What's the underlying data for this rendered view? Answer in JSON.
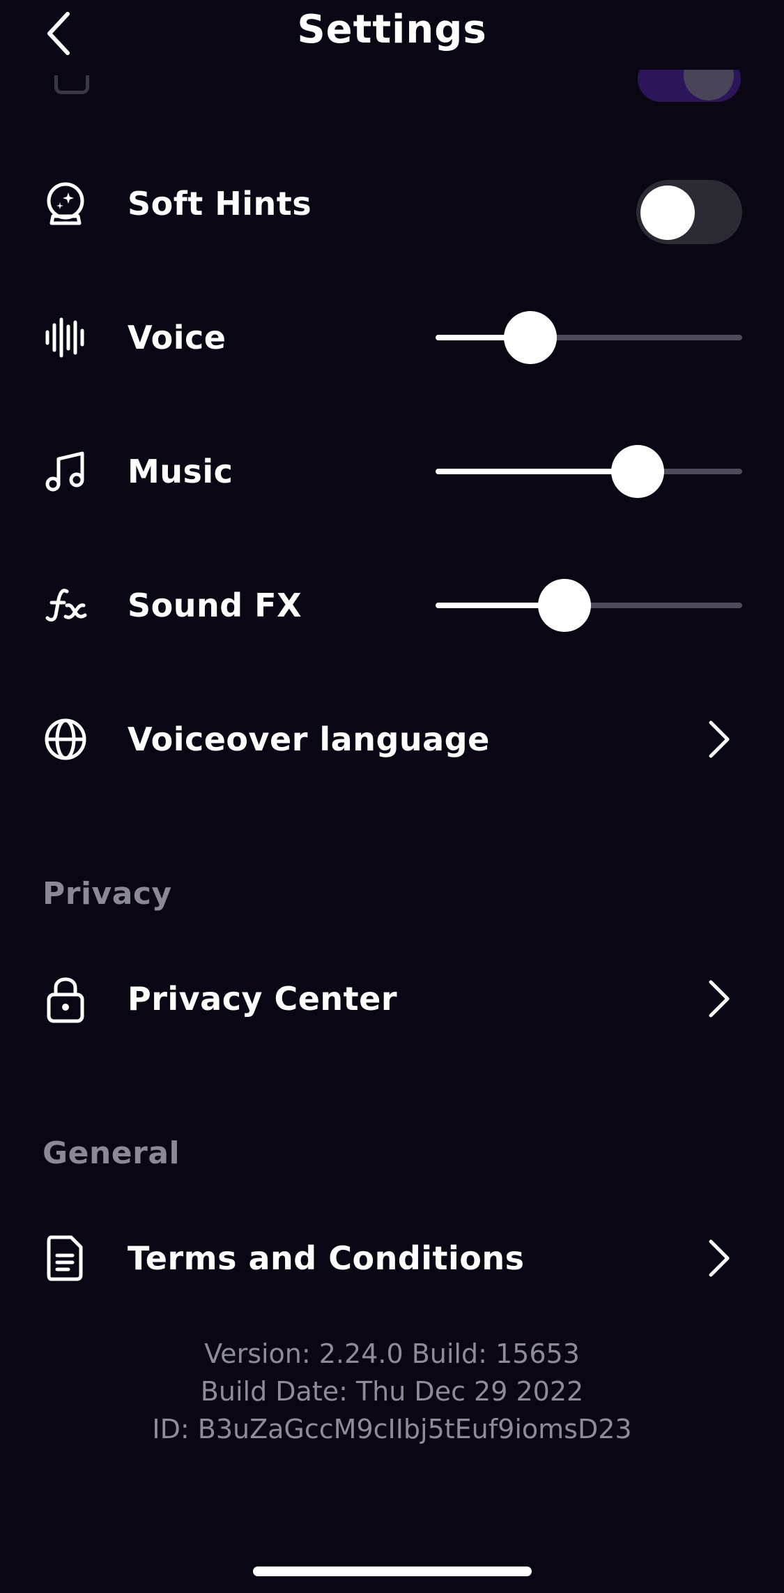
{
  "header": {
    "title": "Settings"
  },
  "audio": {
    "soft_hints": {
      "label": "Soft Hints",
      "on": false
    },
    "voice": {
      "label": "Voice",
      "level": 0.31
    },
    "music": {
      "label": "Music",
      "level": 0.66
    },
    "sound_fx": {
      "label": "Sound FX",
      "level": 0.42
    },
    "voiceover_language": {
      "label": "Voiceover language"
    }
  },
  "privacy": {
    "section_title": "Privacy",
    "privacy_center": {
      "label": "Privacy Center"
    }
  },
  "general": {
    "section_title": "General",
    "terms": {
      "label": "Terms and Conditions"
    }
  },
  "footer": {
    "version_line": "Version: 2.24.0 Build: 15653",
    "build_date_line": "Build Date: Thu Dec 29 2022",
    "id_line": "ID: B3uZaGccM9cIIbj5tEuf9iomsD23"
  },
  "icons": {
    "back": "chevron-left-icon",
    "soft_hints": "crystal-ball-icon",
    "voice": "sound-wave-icon",
    "music": "music-note-icon",
    "sound_fx": "fx-icon",
    "voiceover_language": "globe-icon",
    "privacy_center": "lock-icon",
    "terms": "document-icon"
  },
  "colors": {
    "background": "#0a0614",
    "toggle_off": "#2c2a33",
    "slider_track": "#4f4b5b",
    "section_title": "#8c8897",
    "footer_text": "#8f8b97"
  }
}
